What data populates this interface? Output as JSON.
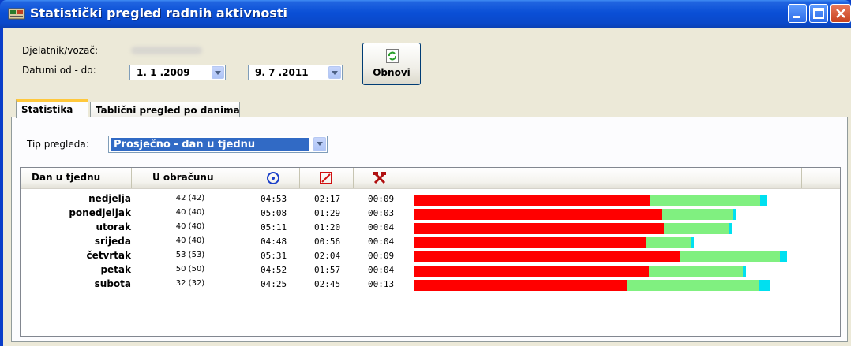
{
  "window": {
    "title": "Statistički pregled radnih aktivnosti"
  },
  "header": {
    "employee_label": "Djelatnik/vozač:",
    "dates_label": "Datumi od - do:",
    "date_from": "1. 1 .2009",
    "date_to": "9. 7 .2011",
    "refresh_label": "Obnovi"
  },
  "tabs": [
    {
      "label": "Statistika",
      "active": true
    },
    {
      "label": "Tablični pregled po danima",
      "active": false
    }
  ],
  "filter": {
    "label": "Tip pregleda:",
    "selected": "Prosječno - dan u tjednu"
  },
  "table": {
    "columns": [
      "Dan u tjednu",
      "U obračunu"
    ],
    "icons": [
      "driving-circle-icon",
      "work-box-icon",
      "rest-tools-icon"
    ],
    "rows": [
      {
        "day": "nedjelja",
        "count": "42 (42)",
        "t1": "04:53",
        "t2": "02:17",
        "t3": "00:09"
      },
      {
        "day": "ponedjeljak",
        "count": "40 (40)",
        "t1": "05:08",
        "t2": "01:29",
        "t3": "00:03"
      },
      {
        "day": "utorak",
        "count": "40 (40)",
        "t1": "05:11",
        "t2": "01:20",
        "t3": "00:04"
      },
      {
        "day": "srijeda",
        "count": "40 (40)",
        "t1": "04:48",
        "t2": "00:56",
        "t3": "00:04"
      },
      {
        "day": "četvrtak",
        "count": "53 (53)",
        "t1": "05:31",
        "t2": "02:04",
        "t3": "00:09"
      },
      {
        "day": "petak",
        "count": "50 (50)",
        "t1": "04:52",
        "t2": "01:57",
        "t3": "00:04"
      },
      {
        "day": "subota",
        "count": "32 (32)",
        "t1": "04:25",
        "t2": "02:45",
        "t3": "00:13"
      }
    ]
  },
  "colors": {
    "t1": "#ff0000",
    "t2": "#80f080",
    "t3": "#00e0f0"
  }
}
